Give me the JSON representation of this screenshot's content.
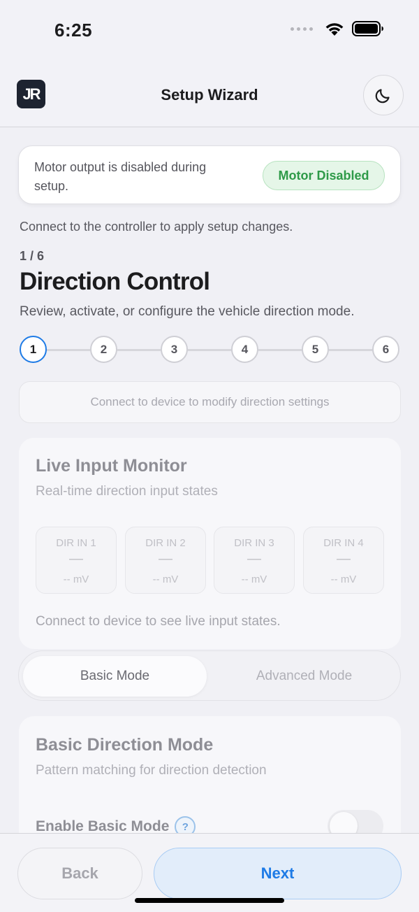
{
  "status_bar": {
    "time": "6:25",
    "icons": [
      "signal-icon",
      "wifi-icon",
      "battery-icon"
    ]
  },
  "header": {
    "logo_text": "JR",
    "title": "Setup Wizard",
    "theme_icon": "moon-icon"
  },
  "motor_banner": {
    "text": "Motor output is disabled during setup.",
    "badge": "Motor Disabled",
    "badge_color": "#2e9a48"
  },
  "connect_note": "Connect to the controller to apply setup changes.",
  "step": {
    "count": "1 / 6",
    "title": "Direction Control",
    "subtitle": "Review, activate, or configure the vehicle direction mode.",
    "current": 1,
    "steps": [
      "1",
      "2",
      "3",
      "4",
      "5",
      "6"
    ]
  },
  "device_note": "Connect to device to modify direction settings",
  "live_monitor": {
    "title": "Live Input Monitor",
    "subtitle": "Real-time direction input states",
    "inputs": [
      {
        "label": "DIR IN 1",
        "value": "—",
        "mv": "-- mV"
      },
      {
        "label": "DIR IN 2",
        "value": "—",
        "mv": "-- mV"
      },
      {
        "label": "DIR IN 3",
        "value": "—",
        "mv": "-- mV"
      },
      {
        "label": "DIR IN 4",
        "value": "—",
        "mv": "-- mV"
      }
    ],
    "footer": "Connect to device to see live input states."
  },
  "mode_toggle": {
    "basic": "Basic Mode",
    "advanced": "Advanced Mode",
    "selected": "basic"
  },
  "basic_mode": {
    "title": "Basic Direction Mode",
    "subtitle": "Pattern matching for direction detection",
    "enable_label": "Enable Basic Mode",
    "help": "?",
    "enabled": false
  },
  "footer": {
    "back": "Back",
    "next": "Next",
    "accent": "#1e7be6"
  }
}
